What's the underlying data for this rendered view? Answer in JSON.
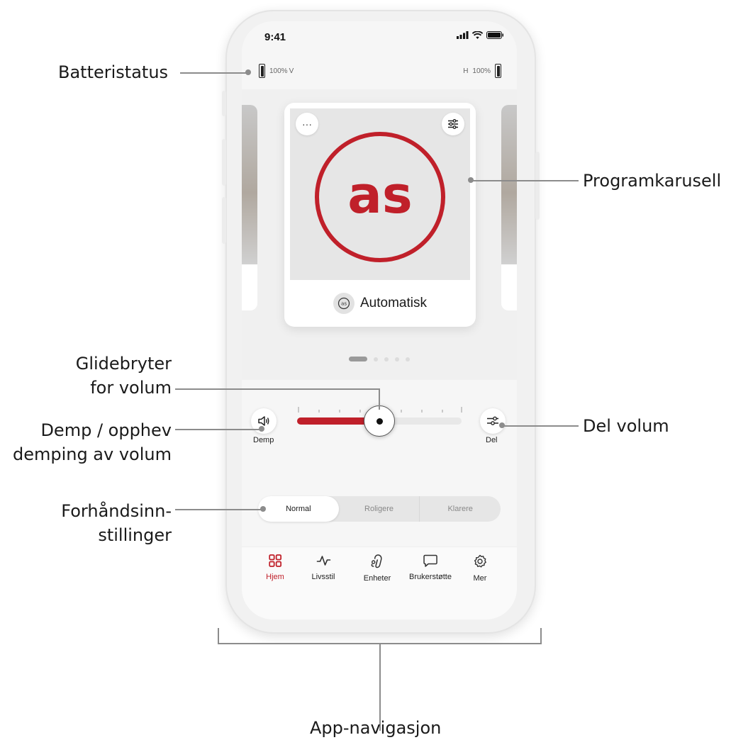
{
  "annotations": {
    "battery": "Batteristatus",
    "carousel": "Programkarusell",
    "slider_line1": "Glidebryter",
    "slider_line2": "for volum",
    "mute_line1": "Demp / opphev",
    "mute_line2": "demping av volum",
    "share": "Del volum",
    "presets_line1": "Forhåndsinn-",
    "presets_line2": "stillinger",
    "nav": "App-navigasjon"
  },
  "status_bar": {
    "time": "9:41"
  },
  "battery": {
    "left_percent": "100%",
    "left_side": "V",
    "right_side": "H",
    "right_percent": "100%"
  },
  "program": {
    "title": "Automatisk",
    "more_label": "···",
    "brand_color": "#c0202a"
  },
  "pager": {
    "count": 5,
    "active_index": 0
  },
  "volume": {
    "mute_label": "Demp",
    "share_label": "Del",
    "level": 0.5
  },
  "presets": {
    "options": [
      "Normal",
      "Roligere",
      "Klarere"
    ],
    "selected": "Normal"
  },
  "nav": {
    "items": [
      {
        "label": "Hjem",
        "icon": "grid-icon"
      },
      {
        "label": "Livsstil",
        "icon": "activity-icon"
      },
      {
        "label": "Enheter",
        "icon": "hearing-aid-icon"
      },
      {
        "label": "Brukerstøtte",
        "icon": "chat-icon"
      },
      {
        "label": "Mer",
        "icon": "gear-icon"
      }
    ],
    "active": "Hjem",
    "active_color": "#c0202a"
  }
}
